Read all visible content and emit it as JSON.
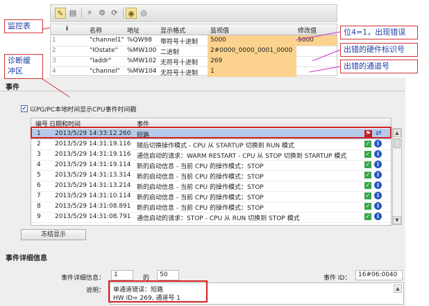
{
  "watch_table": {
    "headers": {
      "name": "名称",
      "address": "地址",
      "format": "显示格式",
      "monitor": "监视值",
      "modify": "修改值"
    },
    "rows": [
      {
        "idx": "1",
        "name": "\"channel1\"",
        "address": "%QW98",
        "format": "带符号十进制",
        "monitor": "5000",
        "modify": "5000"
      },
      {
        "idx": "2",
        "name": "\"IOstate\"",
        "address": "%MW100",
        "format": "二进制",
        "monitor": "2#0000_0000_0001_0000",
        "modify": ""
      },
      {
        "idx": "3",
        "name": "\"laddr\"",
        "address": "%MW102",
        "format": "无符号十进制",
        "monitor": "269",
        "modify": ""
      },
      {
        "idx": "4",
        "name": "\"channel\"",
        "address": "%MW104",
        "format": "无符号十进制",
        "monitor": "1",
        "modify": ""
      }
    ]
  },
  "callouts": {
    "watch": "监控表",
    "diag_line1": "诊断缓",
    "diag_line2": "冲区",
    "bit4": "位4=1，出现错误",
    "hwid": "出错的硬件标识号",
    "channel": "出错的通道号"
  },
  "events_panel": {
    "title": "事件",
    "checkbox_label": "以PG/PC本地时间显示CPU事件时间戳",
    "headers": {
      "no": "编号",
      "datetime": "日期和时间",
      "event": "事件"
    },
    "rows": [
      {
        "no": "1",
        "datetime": "2013/5/29 14:33:12.260",
        "event": "短路"
      },
      {
        "no": "2",
        "datetime": "2013/5/29 14:31:19.116",
        "event": "随后切换操作模式 - CPU 从 STARTUP 切换到 RUN 模式"
      },
      {
        "no": "3",
        "datetime": "2013/5/29 14:31:19.116",
        "event": "通信启动的请求：WARM RESTART - CPU 从 STOP 切换到 STARTUP 模式"
      },
      {
        "no": "4",
        "datetime": "2013/5/29 14:31:19.114",
        "event": "新的启动信息 - 当前 CPU 的操作模式：STOP"
      },
      {
        "no": "5",
        "datetime": "2013/5/29 14:31:13.314",
        "event": "新的启动信息 - 当前 CPU 的操作模式：STOP"
      },
      {
        "no": "6",
        "datetime": "2013/5/29 14:31:13.214",
        "event": "新的启动信息 - 当前 CPU 的操作模式：STOP"
      },
      {
        "no": "7",
        "datetime": "2013/5/29 14:31:10.114",
        "event": "新的启动信息 - 当前 CPU 的操作模式：STOP"
      },
      {
        "no": "8",
        "datetime": "2013/5/29 14:31:08.891",
        "event": "新的启动信息 - 当前 CPU 的操作模式：STOP"
      },
      {
        "no": "9",
        "datetime": "2013/5/29 14:31:08.791",
        "event": "通信启动的请求：STOP - CPU 从 RUN 切换到 STOP 模式"
      }
    ],
    "freeze_button": "冻结显示"
  },
  "details": {
    "title": "事件详细信息",
    "detail_label": "事件详细信息：",
    "detail_value": "1",
    "of_label": "的",
    "of_value": "50",
    "event_id_label": "事件 ID：",
    "event_id_value": "16#06:0040",
    "desc_label": "说明：",
    "desc_line1": "单通道错误：短路",
    "desc_line2": "HW ID=  269,  通道号   1"
  },
  "colors": {
    "highlight": "#fbd38f",
    "callout_border": "#cc3333",
    "callout_text": "#1f3fa8",
    "red_box": "#d42020",
    "selected_row": "#b6c9e8"
  }
}
